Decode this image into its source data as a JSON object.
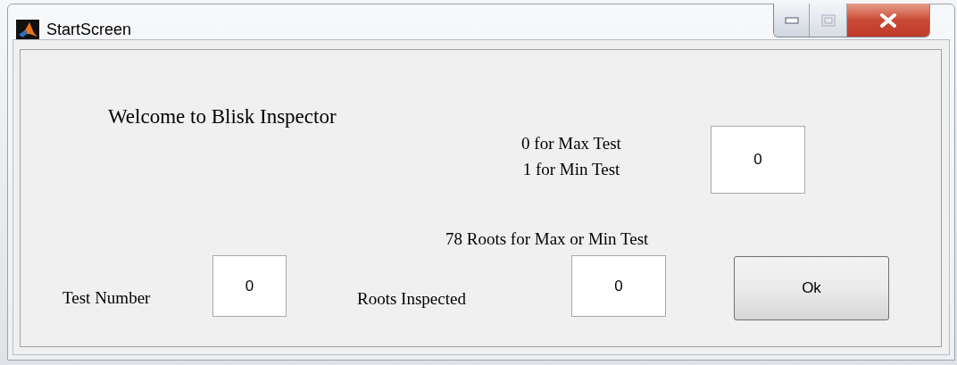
{
  "window": {
    "title": "StartScreen"
  },
  "welcome": "Welcome to Blisk Inspector",
  "mode": {
    "label_lines": [
      "0 for Max Test",
      "1 for Min Test"
    ],
    "value": "0"
  },
  "roots_note": "78 Roots for Max or Min Test",
  "test_number": {
    "label": "Test Number",
    "value": "0"
  },
  "roots_inspected": {
    "label": "Roots Inspected",
    "value": "0"
  },
  "ok_button": "Ok"
}
